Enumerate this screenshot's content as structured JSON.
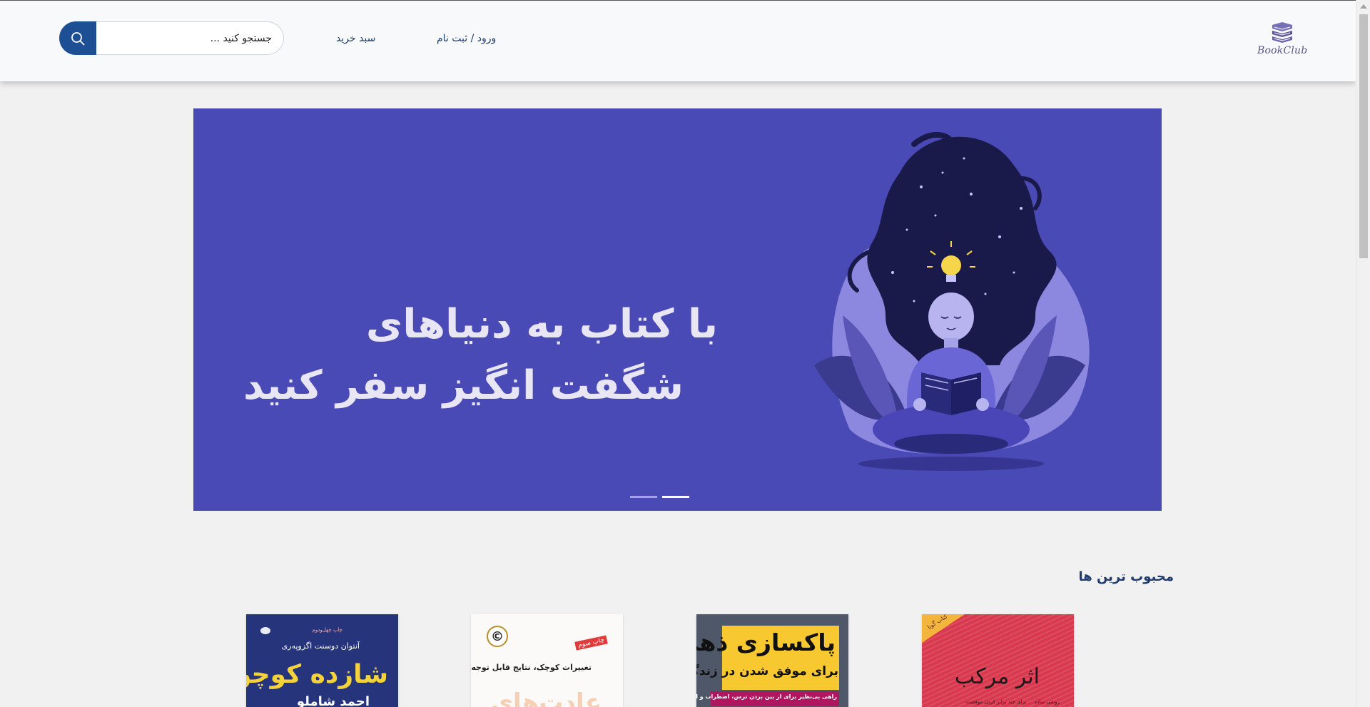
{
  "header": {
    "logo_text": "BookClub",
    "nav": {
      "login": "ورود / ثبت نام",
      "cart": "سبد خرید"
    },
    "search": {
      "placeholder": "جستجو کنید ..."
    }
  },
  "hero": {
    "line1": "با کتاب به دنیاهای",
    "line2": "شگفت انگیز سفر کنید",
    "slides_count": 2,
    "active_slide": 2
  },
  "popular": {
    "title": "محبوب ترین ها",
    "books": [
      {
        "title": "اثر مرکب",
        "badge": "کتاب گویا",
        "subtitle": "روشی ساده ... برای چند برابر کردن موفقیت"
      },
      {
        "title": "پاکسازی ذهن",
        "line2": "برای موفق شدن در زندگی",
        "line3": "راهی بی‌نظیر برای از بین بردن ترس، اضطراب و افکار منفی"
      },
      {
        "title": "تغییرات کوچک، نتایج قابل توجه",
        "stamp": "چاپ سوم",
        "big": "عادت‌های"
      },
      {
        "edition": "چاپ چهل‌ودوم",
        "author": "آنتوان دوسنت اگزوپه‌ری",
        "title": "شازده کوچولو",
        "translator": "احمد شاملو"
      }
    ]
  },
  "colors": {
    "brand_blue": "#1d4f95",
    "hero_bg": "#4a4ab6",
    "text_dark_blue": "#1f3a6b"
  }
}
